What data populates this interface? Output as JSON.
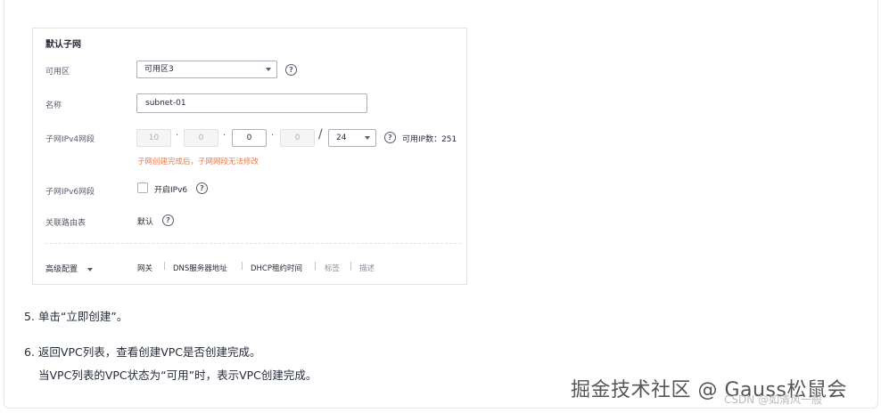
{
  "panel": {
    "title": "默认子网",
    "az_label": "可用区",
    "az_value": "可用区3",
    "name_label": "名称",
    "name_value": "subnet-01",
    "ipv4_label": "子网IPv4网段",
    "ipv4_octets": [
      "10",
      "0",
      "0",
      "0"
    ],
    "ipv4_mask": "24",
    "available_ip": "可用IP数：251",
    "ipv4_note": "子网创建完成后，子网网段无法修改",
    "ipv6_label": "子网IPv6网段",
    "ipv6_checkbox_label": "开启IPv6",
    "route_label": "关联路由表",
    "route_value": "默认",
    "advanced_label": "高级配置",
    "advanced_links": [
      "网关",
      "DNS服务器地址",
      "DHCP租约时间",
      "标签",
      "描述"
    ],
    "separator": "|"
  },
  "steps": {
    "step5": "5. 单击“立即创建”。",
    "step6": "6. 返回VPC列表，查看创建VPC是否创建完成。",
    "step6_detail": "当VPC列表的VPC状态为“可用”时，表示VPC创建完成。"
  },
  "watermarks": {
    "main": "掘金技术社区 @ Gauss松鼠会",
    "secondary": "CSDN @如清风一般"
  },
  "colors": {
    "note": "#e37d4f",
    "text": "#252b3a",
    "border": "#adb0b8"
  },
  "icons": {
    "help": "question-circle-icon",
    "dropdown": "caret-down-icon"
  }
}
